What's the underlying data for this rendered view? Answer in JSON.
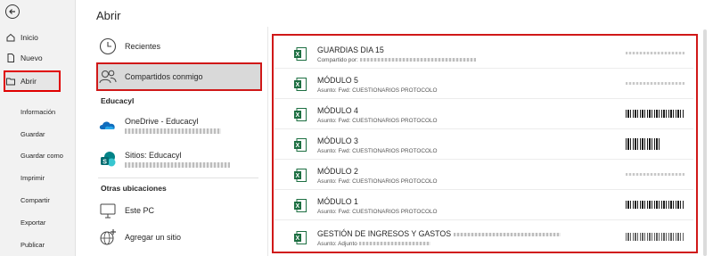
{
  "nav": {
    "top_items": [
      {
        "label": "Inicio",
        "icon": "home-icon"
      },
      {
        "label": "Nuevo",
        "icon": "new-document-icon"
      },
      {
        "label": "Abrir",
        "icon": "open-folder-icon"
      }
    ],
    "sub_items": [
      "Información",
      "Guardar",
      "Guardar como",
      "Imprimir",
      "Compartir",
      "Exportar",
      "Publicar"
    ]
  },
  "main": {
    "title": "Abrir",
    "locations": {
      "recientes": "Recientes",
      "compartidos": "Compartidos conmigo",
      "group_educacyl": "Educacyl",
      "onedrive": "OneDrive - Educacyl",
      "sitios": "Sitios: Educacyl",
      "group_otras": "Otras ubicaciones",
      "este_pc": "Este PC",
      "agregar": "Agregar un sitio"
    }
  },
  "files": [
    {
      "name": "GUARDIAS DIA 15",
      "sub": "Compartido por:"
    },
    {
      "name": "MÓDULO 5",
      "sub": "Asunto: Fwd: CUESTIONARIOS PROTOCOLO"
    },
    {
      "name": "MÓDULO 4",
      "sub": "Asunto: Fwd: CUESTIONARIOS PROTOCOLO"
    },
    {
      "name": "MÓDULO 3",
      "sub": "Asunto: Fwd: CUESTIONARIOS PROTOCOLO"
    },
    {
      "name": "MÓDULO 2",
      "sub": "Asunto: Fwd: CUESTIONARIOS PROTOCOLO"
    },
    {
      "name": "MÓDULO 1",
      "sub": "Asunto: Fwd: CUESTIONARIOS PROTOCOLO"
    },
    {
      "name": "GESTIÓN DE INGRESOS Y GASTOS",
      "sub": "Asunto: Adjunto"
    }
  ],
  "colors": {
    "highlight_border": "#d01818",
    "excel_green": "#1d6f42",
    "nav_bg": "#f2f2f2"
  }
}
